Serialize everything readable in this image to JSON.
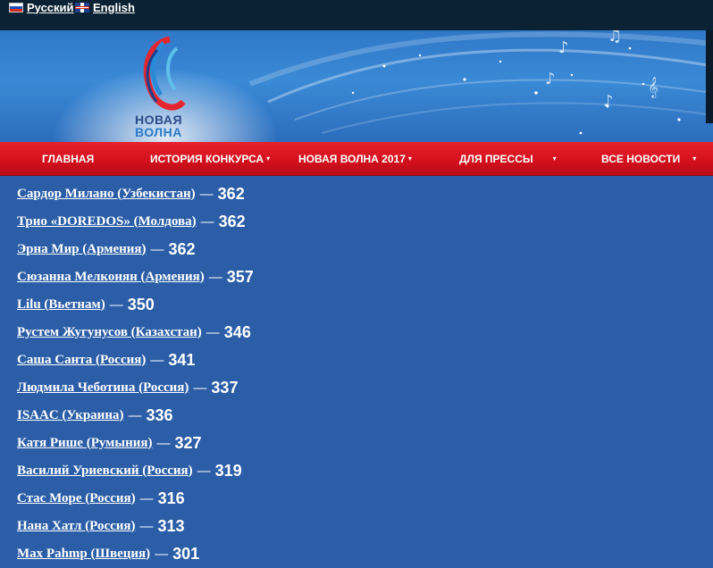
{
  "lang": {
    "ru_label": "Русский",
    "en_label": "English",
    "ru_flag": "russia-flag-icon",
    "en_flag": "uk-flag-icon"
  },
  "logo": {
    "line1": "НОВАЯ",
    "line2": "ВОЛНА"
  },
  "nav": {
    "items": [
      {
        "label": "ГЛАВНАЯ",
        "dropdown": false
      },
      {
        "label": "ИСТОРИЯ КОНКУРСА",
        "dropdown": true
      },
      {
        "label": "НОВАЯ ВОЛНА 2017",
        "dropdown": true
      },
      {
        "label": "ДЛЯ ПРЕССЫ",
        "dropdown": true
      },
      {
        "label": "ВСЕ НОВОСТИ",
        "dropdown": true
      }
    ],
    "caret": "▾"
  },
  "results": {
    "separator": "—",
    "rows": [
      {
        "name": "Сардор Милано (Узбекистан)",
        "score": "362"
      },
      {
        "name": "Трио «DOREDOS» (Молдова)",
        "score": "362"
      },
      {
        "name": "Эрна Мир (Армения)",
        "score": "362"
      },
      {
        "name": "Сюзанна Мелконян (Армения)",
        "score": "357"
      },
      {
        "name": "Lilu (Вьетнам)",
        "score": "350"
      },
      {
        "name": "Рустем Жугунусов (Казахстан)",
        "score": "346"
      },
      {
        "name": "Саша Санта (Россия)",
        "score": "341"
      },
      {
        "name": "Людмила Чеботина (Россия)",
        "score": "337"
      },
      {
        "name": "ISAAC (Украина)",
        "score": "336"
      },
      {
        "name": "Катя Рише (Румыния)",
        "score": "327"
      },
      {
        "name": "Василий Уриевский (Россия)",
        "score": "319"
      },
      {
        "name": "Стас Море (Россия)",
        "score": "316"
      },
      {
        "name": "Нана Хатл (Россия)",
        "score": "313"
      },
      {
        "name": "Max Pahmp (Швеция)",
        "score": "301"
      }
    ]
  },
  "colors": {
    "page_bg": "#2b5ea7",
    "topbar_bg": "#0a2233",
    "nav_red": "#d1101c"
  }
}
